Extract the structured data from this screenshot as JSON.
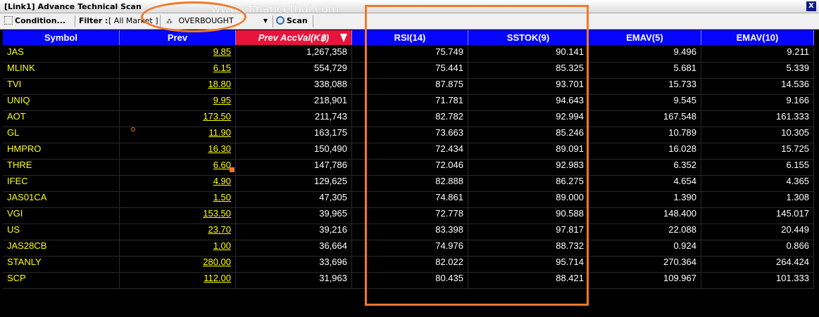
{
  "window": {
    "title": "[Link1] Advance Technical Scan",
    "close": "X"
  },
  "toolbar": {
    "condition_label": "Condition...",
    "filter_label": "Filter :",
    "filter_value": "[ All Market ]",
    "condition_value": "OVERBOUGHT",
    "scan_label": "Scan"
  },
  "watermark": "www.efinancethai.com",
  "table": {
    "columns": [
      "Symbol",
      "Prev",
      "Prev AccVal(K฿)",
      "RSI(14)",
      "SSTOK(9)",
      "EMAV(5)",
      "EMAV(10)"
    ],
    "sorted_column": "Prev AccVal(K฿)",
    "rows": [
      [
        "JAS",
        "9.85",
        "1,267,358",
        "75.749",
        "90.141",
        "9.496",
        "9.211"
      ],
      [
        "MLINK",
        "6.15",
        "554,729",
        "75.441",
        "85.325",
        "5.681",
        "5.339"
      ],
      [
        "TVI",
        "18.80",
        "338,088",
        "87.875",
        "93.701",
        "15.733",
        "14.536"
      ],
      [
        "UNIQ",
        "9.95",
        "218,901",
        "71.781",
        "94.643",
        "9.545",
        "9.166"
      ],
      [
        "AOT",
        "173.50",
        "211,743",
        "82.782",
        "92.994",
        "167.548",
        "161.333"
      ],
      [
        "GL",
        "11.90",
        "163,175",
        "73.663",
        "85.246",
        "10.789",
        "10.305"
      ],
      [
        "HMPRO",
        "16.30",
        "150,490",
        "72.434",
        "89.091",
        "16.028",
        "15.725"
      ],
      [
        "THRE",
        "6.60",
        "147,786",
        "72.046",
        "92.983",
        "6.352",
        "6.155"
      ],
      [
        "IFEC",
        "4.90",
        "129,625",
        "82.888",
        "86.275",
        "4.654",
        "4.365"
      ],
      [
        "JAS01CA",
        "1.50",
        "47,305",
        "74.861",
        "89.000",
        "1.390",
        "1.308"
      ],
      [
        "VGI",
        "153.50",
        "39,965",
        "72.778",
        "90.588",
        "148.400",
        "145.017"
      ],
      [
        "US",
        "23.70",
        "39,216",
        "83.398",
        "97.817",
        "22.088",
        "20.449"
      ],
      [
        "JAS28CB",
        "1.00",
        "36,664",
        "74.976",
        "88.732",
        "0.924",
        "0.866"
      ],
      [
        "STANLY",
        "280.00",
        "33,696",
        "82.022",
        "95.714",
        "270.364",
        "264.424"
      ],
      [
        "SCP",
        "112.00",
        "31,963",
        "80.435",
        "88.421",
        "109.967",
        "101.333"
      ]
    ]
  },
  "colors": {
    "header_bg": "#0505ff",
    "sorted_header_bg": "#e8143c",
    "symbol_text": "#ffff00",
    "annotation": "#f07a28"
  }
}
